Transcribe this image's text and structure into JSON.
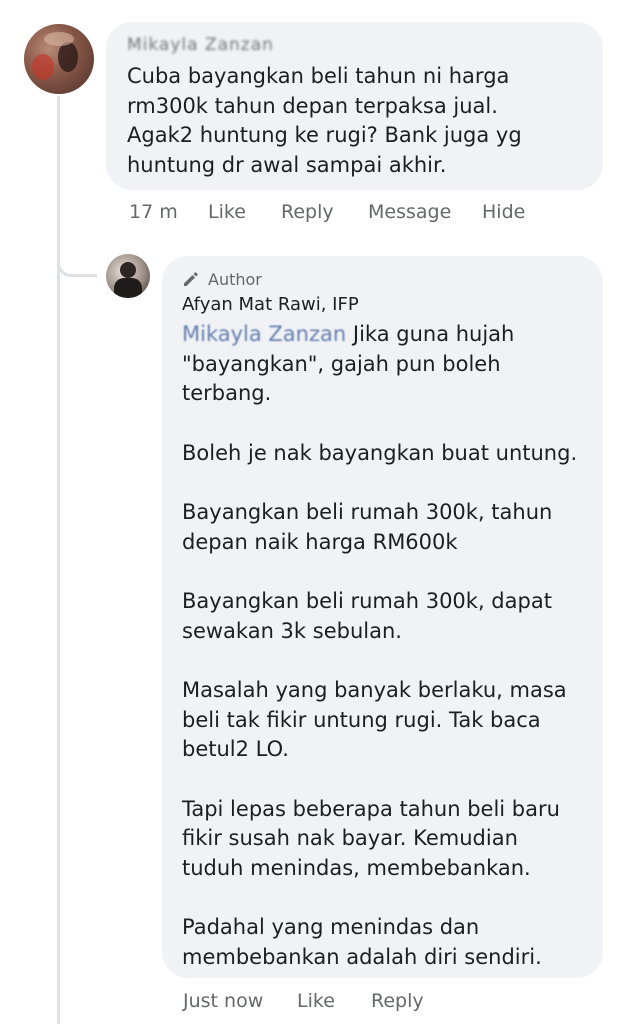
{
  "comment": {
    "author_redacted": "Mikayla Zanzan",
    "text": "Cuba bayangkan beli tahun ni harga rm300k tahun depan terpaksa jual. Agak2 huntung ke rugi? Bank juga yg huntung dr awal sampai akhir.",
    "time": "17 m",
    "actions": {
      "like": "Like",
      "reply": "Reply",
      "message": "Message",
      "hide": "Hide"
    }
  },
  "reply": {
    "badge": "Author",
    "author": "Afyan Mat Rawi, IFP",
    "mention_redacted": "Mikayla Zanzan",
    "paragraphs": [
      "Jika guna hujah \"bayangkan\", gajah pun boleh terbang.",
      "Boleh je nak bayangkan buat untung.",
      "Bayangkan beli rumah 300k, tahun depan naik harga RM600k",
      "Bayangkan beli rumah 300k, dapat sewakan 3k sebulan.",
      "Masalah yang banyak berlaku, masa beli tak fikir untung rugi. Tak baca betul2 LO.",
      "Tapi lepas beberapa tahun beli baru fikir susah nak bayar. Kemudian tuduh menindas, membebankan.",
      "Padahal yang menindas dan membebankan adalah diri sendiri."
    ],
    "time": "Just now",
    "actions": {
      "like": "Like",
      "reply": "Reply"
    }
  }
}
